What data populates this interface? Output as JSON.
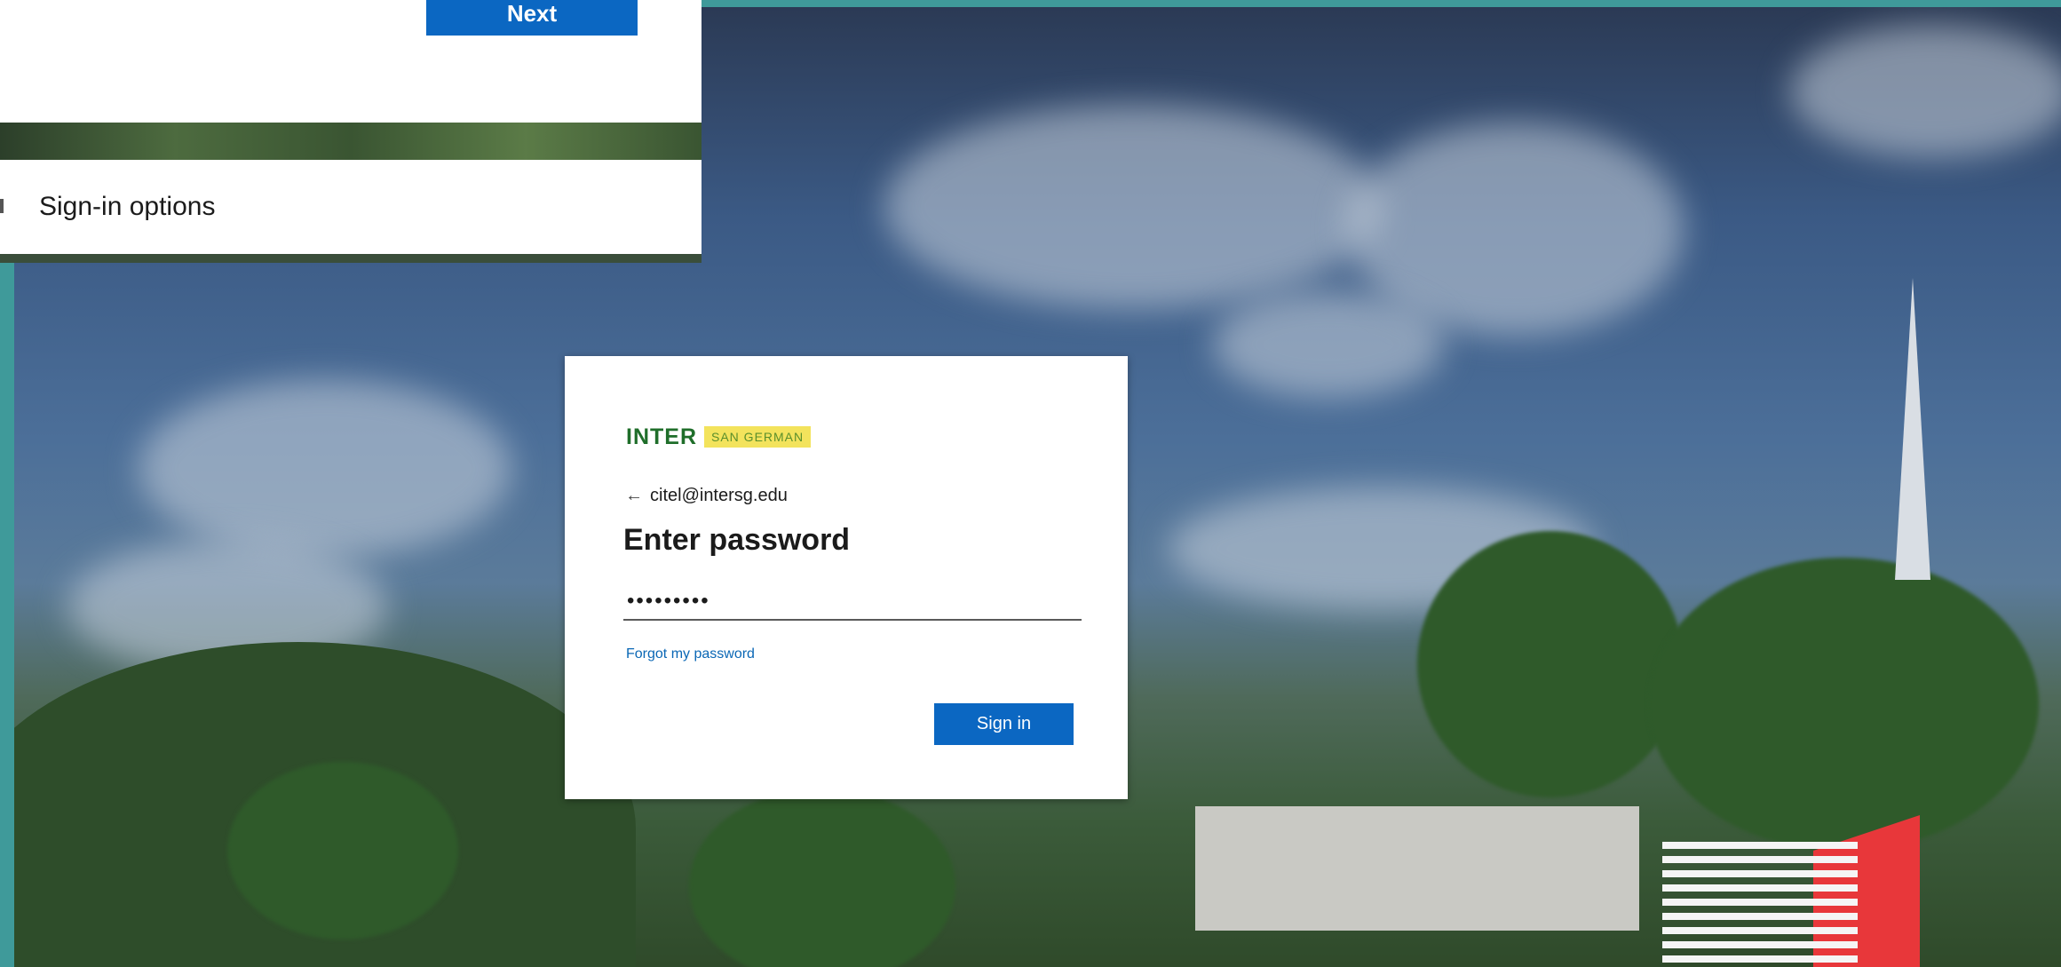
{
  "top_card": {
    "next_label": "Next",
    "signin_options_label": "Sign-in options"
  },
  "login": {
    "logo_main": "INTER",
    "logo_campus": "SAN GERMAN",
    "account": "citel@intersg.edu",
    "title": "Enter password",
    "password_value": "•••••••••",
    "forgot_label": "Forgot my password",
    "signin_label": "Sign in"
  },
  "colors": {
    "primary_button": "#0b67c2",
    "frame": "#3f9a9a",
    "link": "#0a67b5"
  },
  "icons": {
    "back": "arrow-left-icon",
    "signin_options": "key-icon",
    "brand": "red-white-stripes-logo"
  }
}
